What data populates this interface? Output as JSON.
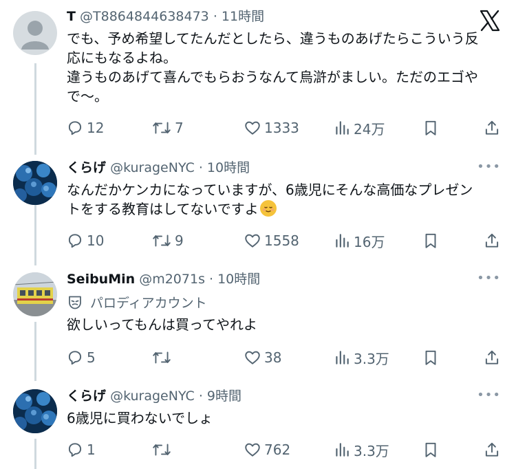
{
  "tweets": [
    {
      "name": "T",
      "handle": "@T8864844638473",
      "time": "· 11時間",
      "lines": [
        "でも、予め希望してたんだとしたら、違うものあげたらこういう反",
        "応にもなるよね。",
        "違うものあげて喜んでもらおうなんて烏滸がましい。ただのエゴや",
        "で〜。"
      ],
      "replies": "12",
      "retweets": "7",
      "likes": "1333",
      "views": "24万"
    },
    {
      "name": "くらげ",
      "handle": "@kurageNYC",
      "time": "· 10時間",
      "lines": [
        "なんだかケンカになっていますが、6歳児にそんな高価なプレゼン",
        "トをする教育はしてないですよ"
      ],
      "emoji": "relieved-face",
      "replies": "10",
      "retweets": "9",
      "likes": "1558",
      "views": "16万"
    },
    {
      "name": "SeibuMin",
      "handle": "@m2071s",
      "time": "· 10時間",
      "parody_label": "パロディアカウント",
      "lines": [
        "欲しいってもんは買ってやれよ"
      ],
      "replies": "5",
      "retweets": "",
      "likes": "38",
      "views": "3.3万"
    },
    {
      "name": "くらげ",
      "handle": "@kurageNYC",
      "time": "· 9時間",
      "lines": [
        "6歳児に買わないでしょ"
      ],
      "replies": "1",
      "retweets": "",
      "likes": "762",
      "views": "3.3万"
    }
  ],
  "icons": {
    "brand": "x-logo-icon",
    "reply": "reply-icon",
    "retweet": "retweet-icon",
    "like": "heart-icon",
    "views": "views-icon",
    "bookmark": "bookmark-icon",
    "share": "share-icon",
    "more": "more-icon",
    "parody": "mask-icon"
  },
  "colors": {
    "text": "#0f1419",
    "secondary": "#536471",
    "thread_line": "#cfd9de"
  }
}
